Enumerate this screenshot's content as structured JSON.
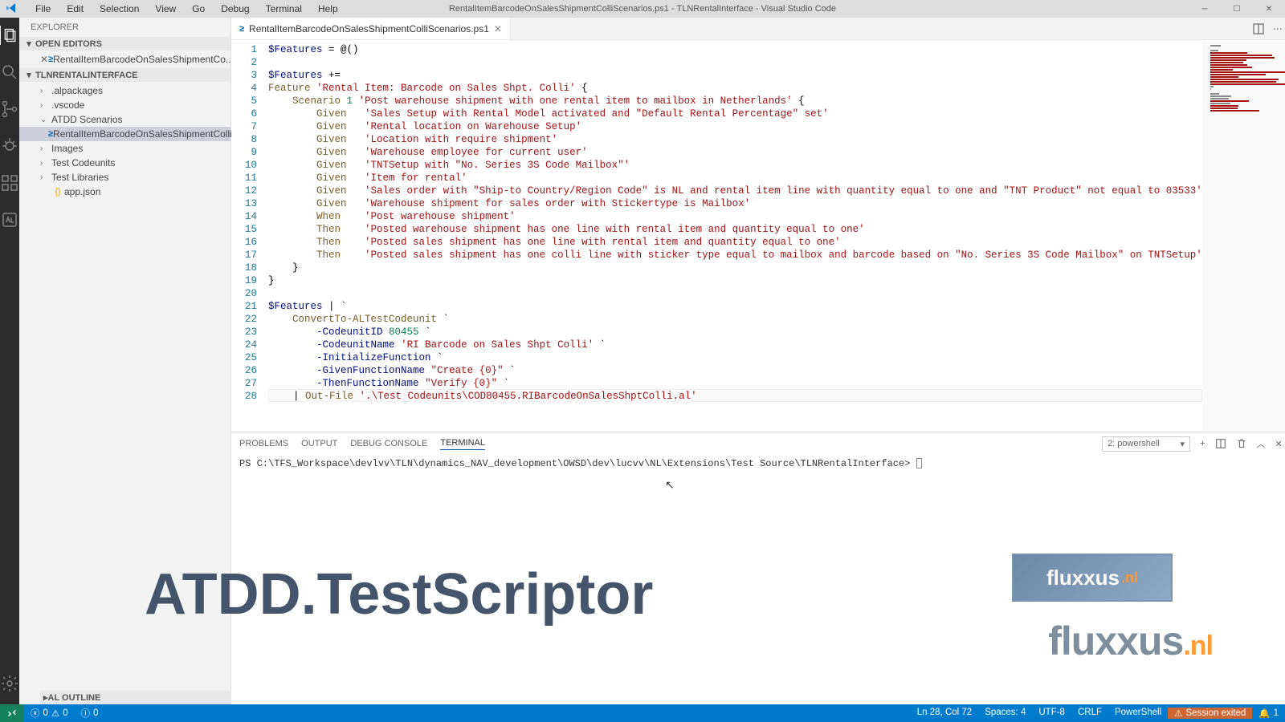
{
  "window": {
    "title": "RentalItemBarcodeOnSalesShipmentColliScenarios.ps1 - TLNRentalInterface - Visual Studio Code"
  },
  "menubar": [
    "File",
    "Edit",
    "Selection",
    "View",
    "Go",
    "Debug",
    "Terminal",
    "Help"
  ],
  "sidebar": {
    "title": "EXPLORER",
    "sections": {
      "openEditors": "OPEN EDITORS",
      "workspace": "TLNRENTALINTERFACE",
      "outline": "AL OUTLINE"
    },
    "openEditorItem": "RentalItemBarcodeOnSalesShipmentCo...",
    "tree": [
      {
        "label": ".alpackages",
        "type": "folder"
      },
      {
        "label": ".vscode",
        "type": "folder"
      },
      {
        "label": "ATDD Scenarios",
        "type": "folder",
        "expanded": true
      },
      {
        "label": "RentalItemBarcodeOnSalesShipmentColliScenari...",
        "type": "ps1",
        "selected": true,
        "indent": 2
      },
      {
        "label": "Images",
        "type": "folder"
      },
      {
        "label": "Test Codeunits",
        "type": "folder"
      },
      {
        "label": "Test Libraries",
        "type": "folder"
      },
      {
        "label": "app.json",
        "type": "json"
      }
    ]
  },
  "tabs": {
    "active": "RentalItemBarcodeOnSalesShipmentColliScenarios.ps1"
  },
  "code": {
    "lines": [
      [
        {
          "c": "tk-var",
          "t": "$Features"
        },
        {
          "c": "tk-op",
          "t": " = @()"
        }
      ],
      [],
      [
        {
          "c": "tk-var",
          "t": "$Features"
        },
        {
          "c": "tk-op",
          "t": " +="
        }
      ],
      [
        {
          "c": "tk-cmd",
          "t": "Feature"
        },
        {
          "c": "tk-op",
          "t": " "
        },
        {
          "c": "tk-str",
          "t": "'Rental Item: Barcode on Sales Shpt. Colli'"
        },
        {
          "c": "tk-op",
          "t": " {"
        }
      ],
      [
        {
          "c": "tk-op",
          "t": "    "
        },
        {
          "c": "tk-cmd",
          "t": "Scenario"
        },
        {
          "c": "tk-op",
          "t": " "
        },
        {
          "c": "tk-num",
          "t": "1"
        },
        {
          "c": "tk-op",
          "t": " "
        },
        {
          "c": "tk-str",
          "t": "'Post warehouse shipment with one rental item to mailbox in Netherlands'"
        },
        {
          "c": "tk-op",
          "t": " {"
        }
      ],
      [
        {
          "c": "tk-op",
          "t": "        "
        },
        {
          "c": "tk-cmd",
          "t": "Given"
        },
        {
          "c": "tk-op",
          "t": "   "
        },
        {
          "c": "tk-str",
          "t": "'Sales Setup with Rental Model activated and \"Default Rental Percentage\" set'"
        }
      ],
      [
        {
          "c": "tk-op",
          "t": "        "
        },
        {
          "c": "tk-cmd",
          "t": "Given"
        },
        {
          "c": "tk-op",
          "t": "   "
        },
        {
          "c": "tk-str",
          "t": "'Rental location on Warehouse Setup'"
        }
      ],
      [
        {
          "c": "tk-op",
          "t": "        "
        },
        {
          "c": "tk-cmd",
          "t": "Given"
        },
        {
          "c": "tk-op",
          "t": "   "
        },
        {
          "c": "tk-str",
          "t": "'Location with require shipment'"
        }
      ],
      [
        {
          "c": "tk-op",
          "t": "        "
        },
        {
          "c": "tk-cmd",
          "t": "Given"
        },
        {
          "c": "tk-op",
          "t": "   "
        },
        {
          "c": "tk-str",
          "t": "'Warehouse employee for current user'"
        }
      ],
      [
        {
          "c": "tk-op",
          "t": "        "
        },
        {
          "c": "tk-cmd",
          "t": "Given"
        },
        {
          "c": "tk-op",
          "t": "   "
        },
        {
          "c": "tk-str",
          "t": "'TNTSetup with \"No. Series 3S Code Mailbox\"'"
        }
      ],
      [
        {
          "c": "tk-op",
          "t": "        "
        },
        {
          "c": "tk-cmd",
          "t": "Given"
        },
        {
          "c": "tk-op",
          "t": "   "
        },
        {
          "c": "tk-str",
          "t": "'Item for rental'"
        }
      ],
      [
        {
          "c": "tk-op",
          "t": "        "
        },
        {
          "c": "tk-cmd",
          "t": "Given"
        },
        {
          "c": "tk-op",
          "t": "   "
        },
        {
          "c": "tk-str",
          "t": "'Sales order with \"Ship-to Country/Region Code\" is NL and rental item line with quantity equal to one and \"TNT Product\" not equal to 03533'"
        }
      ],
      [
        {
          "c": "tk-op",
          "t": "        "
        },
        {
          "c": "tk-cmd",
          "t": "Given"
        },
        {
          "c": "tk-op",
          "t": "   "
        },
        {
          "c": "tk-str",
          "t": "'Warehouse shipment for sales order with Stickertype is Mailbox'"
        }
      ],
      [
        {
          "c": "tk-op",
          "t": "        "
        },
        {
          "c": "tk-cmd",
          "t": "When"
        },
        {
          "c": "tk-op",
          "t": "    "
        },
        {
          "c": "tk-str",
          "t": "'Post warehouse shipment'"
        }
      ],
      [
        {
          "c": "tk-op",
          "t": "        "
        },
        {
          "c": "tk-cmd",
          "t": "Then"
        },
        {
          "c": "tk-op",
          "t": "    "
        },
        {
          "c": "tk-str",
          "t": "'Posted warehouse shipment has one line with rental item and quantity equal to one'"
        }
      ],
      [
        {
          "c": "tk-op",
          "t": "        "
        },
        {
          "c": "tk-cmd",
          "t": "Then"
        },
        {
          "c": "tk-op",
          "t": "    "
        },
        {
          "c": "tk-str",
          "t": "'Posted sales shipment has one line with rental item and quantity equal to one'"
        }
      ],
      [
        {
          "c": "tk-op",
          "t": "        "
        },
        {
          "c": "tk-cmd",
          "t": "Then"
        },
        {
          "c": "tk-op",
          "t": "    "
        },
        {
          "c": "tk-str",
          "t": "'Posted sales shipment has one colli line with sticker type equal to mailbox and barcode based on \"No. Series 3S Code Mailbox\" on TNTSetup'"
        }
      ],
      [
        {
          "c": "tk-op",
          "t": "    }"
        }
      ],
      [
        {
          "c": "tk-op",
          "t": "}"
        }
      ],
      [],
      [
        {
          "c": "tk-var",
          "t": "$Features"
        },
        {
          "c": "tk-op",
          "t": " | `"
        }
      ],
      [
        {
          "c": "tk-op",
          "t": "    "
        },
        {
          "c": "tk-cmd",
          "t": "ConvertTo-ALTestCodeunit"
        },
        {
          "c": "tk-op",
          "t": " `"
        }
      ],
      [
        {
          "c": "tk-op",
          "t": "        "
        },
        {
          "c": "tk-param",
          "t": "-CodeunitID"
        },
        {
          "c": "tk-op",
          "t": " "
        },
        {
          "c": "tk-num",
          "t": "80455"
        },
        {
          "c": "tk-op",
          "t": " `"
        }
      ],
      [
        {
          "c": "tk-op",
          "t": "        "
        },
        {
          "c": "tk-param",
          "t": "-CodeunitName"
        },
        {
          "c": "tk-op",
          "t": " "
        },
        {
          "c": "tk-str",
          "t": "'RI Barcode on Sales Shpt Colli'"
        },
        {
          "c": "tk-op",
          "t": " `"
        }
      ],
      [
        {
          "c": "tk-op",
          "t": "        "
        },
        {
          "c": "tk-param",
          "t": "-InitializeFunction"
        },
        {
          "c": "tk-op",
          "t": " `"
        }
      ],
      [
        {
          "c": "tk-op",
          "t": "        "
        },
        {
          "c": "tk-param",
          "t": "-GivenFunctionName"
        },
        {
          "c": "tk-op",
          "t": " "
        },
        {
          "c": "tk-str",
          "t": "\"Create {0}\""
        },
        {
          "c": "tk-op",
          "t": " `"
        }
      ],
      [
        {
          "c": "tk-op",
          "t": "        "
        },
        {
          "c": "tk-param",
          "t": "-ThenFunctionName"
        },
        {
          "c": "tk-op",
          "t": " "
        },
        {
          "c": "tk-str",
          "t": "\"Verify {0}\""
        },
        {
          "c": "tk-op",
          "t": " `"
        }
      ],
      [
        {
          "c": "tk-op",
          "t": "    | "
        },
        {
          "c": "tk-cmd",
          "t": "Out-File"
        },
        {
          "c": "tk-op",
          "t": " "
        },
        {
          "c": "tk-str",
          "t": "'.\\Test Codeunits\\COD80455.RIBarcodeOnSalesShptColli.al'"
        }
      ]
    ]
  },
  "panel": {
    "tabs": [
      "PROBLEMS",
      "OUTPUT",
      "DEBUG CONSOLE",
      "TERMINAL"
    ],
    "activeTab": "TERMINAL",
    "selector": "2: powershell",
    "prompt": "PS C:\\TFS_Workspace\\devlvv\\TLN\\dynamics_NAV_development\\OWSD\\dev\\lucvv\\NL\\Extensions\\Test Source\\TLNRentalInterface> "
  },
  "statusbar": {
    "errors": "0",
    "warnings": "0",
    "infos": "0",
    "cursor": "Ln 28, Col 72",
    "spaces": "Spaces: 4",
    "encoding": "UTF-8",
    "eol": "CRLF",
    "lang": "PowerShell",
    "session": "Session exited",
    "bell": "1"
  },
  "overlay": {
    "title": "ATDD.TestScriptor",
    "logo": "fluxxus",
    "nl": ".nl"
  }
}
